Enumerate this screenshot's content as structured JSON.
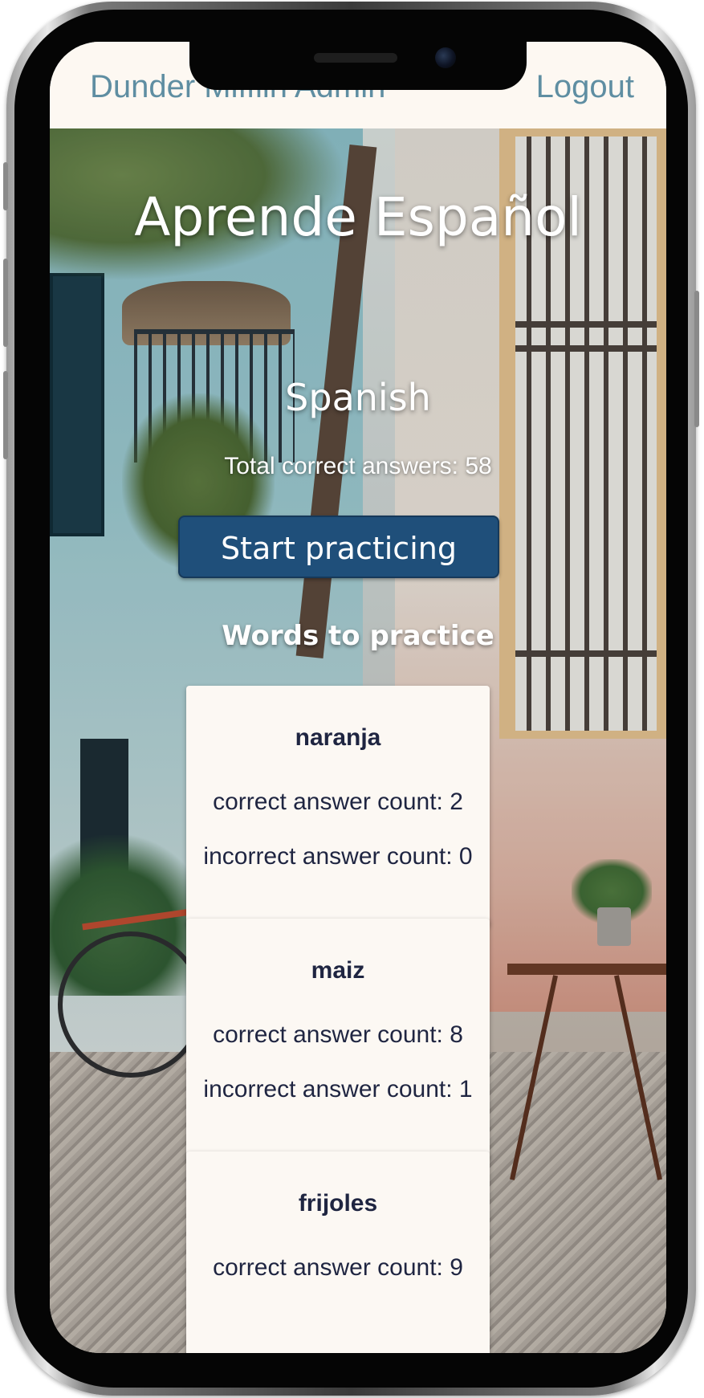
{
  "header": {
    "brand": "Dunder Mifflin Admin",
    "logout_label": "Logout"
  },
  "main": {
    "app_title": "Aprende Español",
    "language": "Spanish",
    "total_label": "Total correct answers: 58",
    "start_label": "Start practicing",
    "section_title": "Words to practice"
  },
  "words": [
    {
      "word": "naranja",
      "correct": "correct answer count: 2",
      "incorrect": "incorrect answer count: 0"
    },
    {
      "word": "maiz",
      "correct": "correct answer count: 8",
      "incorrect": "incorrect answer count: 1"
    },
    {
      "word": "frijoles",
      "correct": "correct answer count: 9",
      "incorrect": ""
    }
  ],
  "colors": {
    "header_bg": "#fdf8f2",
    "header_text": "#5f8ea2",
    "button_bg": "#1f4f7a",
    "card_bg": "#fcf8f3",
    "card_text": "#1f2541"
  }
}
